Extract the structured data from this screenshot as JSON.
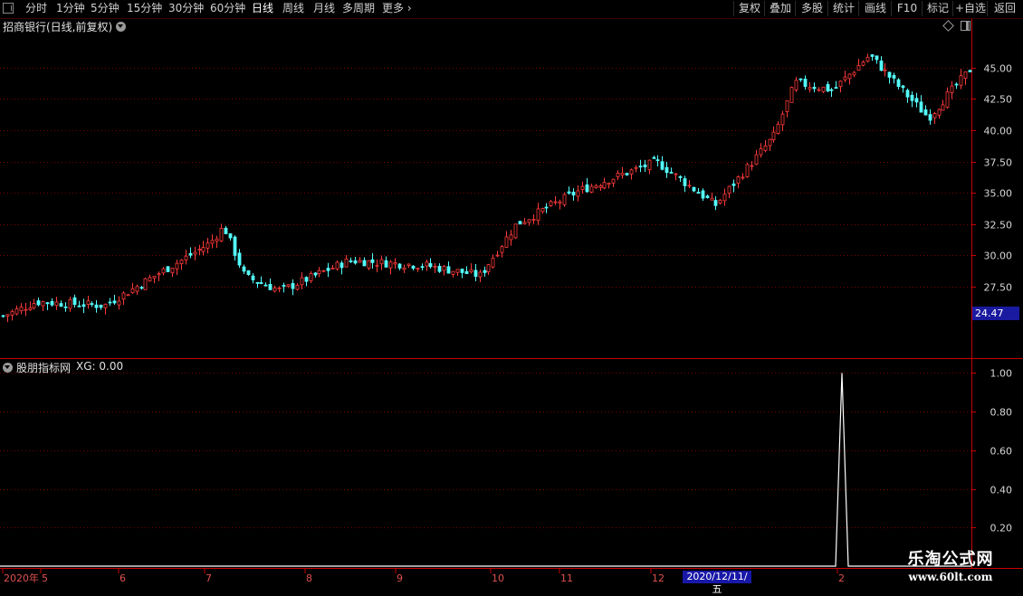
{
  "toolbar": {
    "periods": [
      "分时",
      "1分钟",
      "5分钟",
      "15分钟",
      "30分钟",
      "60分钟",
      "日线",
      "周线",
      "月线",
      "多周期",
      "更多"
    ],
    "active_period": "日线",
    "right_buttons": [
      "复权",
      "叠加",
      "多股",
      "统计",
      "画线",
      "F10",
      "标记",
      "+自选",
      "返回"
    ]
  },
  "main_chart": {
    "title": "招商银行(日线,前复权)",
    "current_price_label": "24.47"
  },
  "indicator": {
    "title": "股朋指标网",
    "xg_label": "XG: 0.00"
  },
  "x_axis": {
    "month_labels": [
      "2020年",
      "5",
      "6",
      "7",
      "8",
      "9",
      "10",
      "11",
      "12",
      "2"
    ],
    "hover_date": "2020/12/11/五"
  },
  "watermark": {
    "line1": "乐淘公式网",
    "line2": "www.60lt.com"
  },
  "colors": {
    "up": "#ff3a3a",
    "down": "#54ffff",
    "axis": "#c80000",
    "highlight": "#1818a8"
  },
  "chart_data": [
    {
      "type": "candlestick",
      "title": "招商银行(日线,前复权)",
      "y_ticks": [
        27.5,
        30.0,
        32.5,
        35.0,
        37.5,
        40.0,
        42.5,
        45.0
      ],
      "ylim": [
        21.8,
        47.8
      ],
      "grid": true,
      "close_waypoints": [
        {
          "date": "2020-04",
          "close": 25.2
        },
        {
          "date": "2020-05",
          "close": 26.3
        },
        {
          "date": "2020-06-end",
          "close": 26.0
        },
        {
          "date": "2020-07-06",
          "close": 31.0
        },
        {
          "date": "2020-07-07",
          "close": 32.3
        },
        {
          "date": "2020-07-mid",
          "close": 28.3
        },
        {
          "date": "2020-07-end",
          "close": 27.2
        },
        {
          "date": "2020-08-end",
          "close": 29.6
        },
        {
          "date": "2020-09-end",
          "close": 29.2
        },
        {
          "date": "2020-10-mid",
          "close": 28.4
        },
        {
          "date": "2020-10-end",
          "close": 32.5
        },
        {
          "date": "2020-11-mid",
          "close": 35.2
        },
        {
          "date": "2020-12-01",
          "close": 37.5
        },
        {
          "date": "2020-12-11",
          "close": 34.0
        },
        {
          "date": "2021-01-05",
          "close": 39.6
        },
        {
          "date": "2021-01-08",
          "close": 43.8
        },
        {
          "date": "2021-01-end",
          "close": 43.2
        },
        {
          "date": "2021-02-mid",
          "close": 46.0
        },
        {
          "date": "2021-02-end",
          "close": 41.0
        },
        {
          "date": "2021-03",
          "close": 45.0
        }
      ],
      "last_price": 24.47
    },
    {
      "type": "line",
      "title": "股朋指标网",
      "series": [
        {
          "name": "XG",
          "signal_dates": [
            "2021-02"
          ],
          "signal_value": 1.0,
          "other_value": 0.0
        }
      ],
      "y_ticks": [
        0.2,
        0.4,
        0.6,
        0.8,
        1.0
      ],
      "ylim": [
        0,
        1.03
      ],
      "grid": true
    }
  ]
}
